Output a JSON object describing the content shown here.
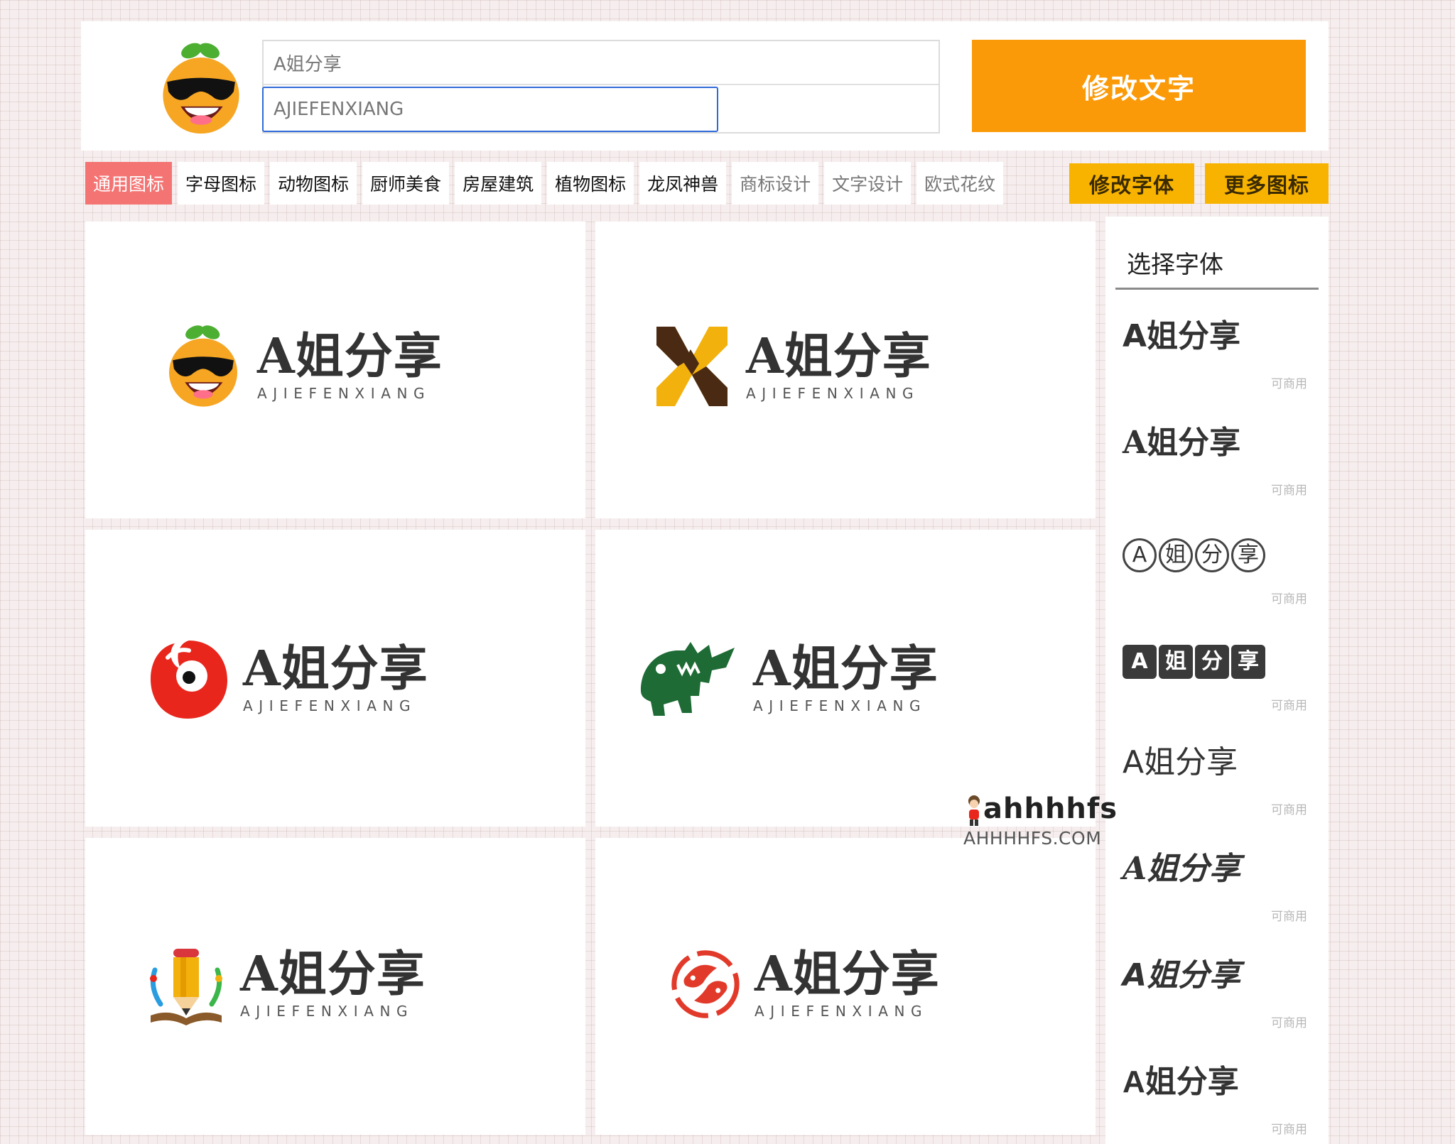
{
  "header": {
    "title_input": {
      "value": "A姐分享"
    },
    "subtitle_input": {
      "value": "AJIEFENXIANG"
    },
    "edit_text_button": "修改文字"
  },
  "tabs": [
    {
      "label": "通用图标",
      "active": true
    },
    {
      "label": "字母图标"
    },
    {
      "label": "动物图标"
    },
    {
      "label": "厨师美食"
    },
    {
      "label": "房屋建筑"
    },
    {
      "label": "植物图标"
    },
    {
      "label": "龙凤神兽"
    },
    {
      "label": "商标设计"
    },
    {
      "label": "文字设计"
    },
    {
      "label": "欧式花纹"
    }
  ],
  "buttons": {
    "edit_font": "修改字体",
    "more_icons": "更多图标"
  },
  "cards": [
    {
      "icon": "sunglasses-orange-icon",
      "title": "A姐分享",
      "subtitle": "AJIEFENXIANG"
    },
    {
      "icon": "geometric-h-icon",
      "title": "A姐分享",
      "subtitle": "AJIEFENXIANG"
    },
    {
      "icon": "red-eye-blob-icon",
      "title": "A姐分享",
      "subtitle": "AJIEFENXIANG"
    },
    {
      "icon": "crocodile-icon",
      "title": "A姐分享",
      "subtitle": "AJIEFENXIANG"
    },
    {
      "icon": "pencil-book-laurel-icon",
      "title": "A姐分享",
      "subtitle": "AJIEFENXIANG"
    },
    {
      "icon": "red-twin-fish-icon",
      "title": "A姐分享",
      "subtitle": "AJIEFENXIANG"
    }
  ],
  "side": {
    "title": "选择字体",
    "fonts": [
      {
        "sample": "A姐分享",
        "tag": "可商用"
      },
      {
        "sample": "A姐分享",
        "tag": "可商用"
      },
      {
        "sample": [
          "A",
          "姐",
          "分",
          "享"
        ],
        "tag": "可商用"
      },
      {
        "sample": [
          "A",
          "姐",
          "分",
          "享"
        ],
        "tag": "可商用"
      },
      {
        "sample": "A姐分享",
        "tag": "可商用"
      },
      {
        "sample": "A姐分享",
        "tag": "可商用"
      },
      {
        "sample": "A姐分享",
        "tag": "可商用"
      },
      {
        "sample": "A姐分享",
        "tag": "可商用"
      }
    ]
  },
  "watermark": {
    "main": "ahhhhfs",
    "sub": "AHHHHFS.COM"
  },
  "colors": {
    "accent_orange": "#fb9a08",
    "button_yellow": "#f8b300",
    "tab_active": "#f47474",
    "input_focus": "#2f6bd8",
    "crocodile_green": "#1e6b35",
    "logo_red": "#e8261c"
  }
}
